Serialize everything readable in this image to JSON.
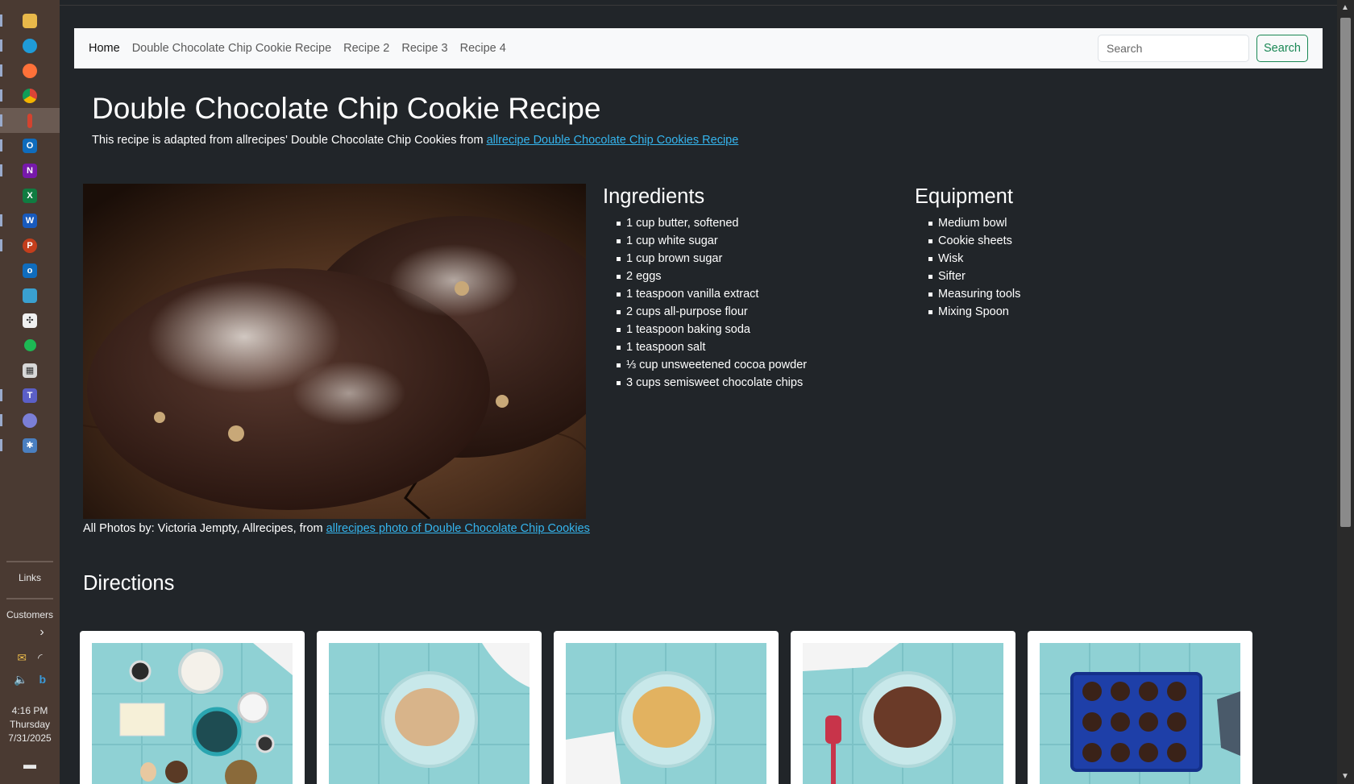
{
  "taskbar": {
    "icons": [
      "file-explorer",
      "edge",
      "firefox",
      "chrome",
      "app-pin",
      "outlook",
      "onenote",
      "excel",
      "word",
      "powerpoint",
      "outlook-alt",
      "app-tool",
      "puzzle",
      "green-circle",
      "calculator",
      "teams",
      "teams-alt",
      "app-gear"
    ],
    "links_label": "Links",
    "customers_label": "Customers",
    "time": "4:16 PM",
    "day": "Thursday",
    "date": "7/31/2025"
  },
  "navbar": {
    "home": "Home",
    "links": [
      "Double Chocolate Chip Cookie Recipe",
      "Recipe 2",
      "Recipe 3",
      "Recipe 4"
    ],
    "search_placeholder": "Search",
    "search_button": "Search"
  },
  "recipe": {
    "title": "Double Chocolate Chip Cookie Recipe",
    "subtitle": "This recipe is adapted from allrecipes' Double Chocolate Chip Cookies from ",
    "subtitle_link": "allrecipe Double Chocolate Chip Cookies Recipe",
    "credit": "All Photos by: Victoria Jempty, Allrecipes, from ",
    "credit_link": "allrecipes photo of Double Chocolate Chip Cookies",
    "ingredients_heading": "Ingredients",
    "ingredients": [
      "1 cup butter, softened",
      "1 cup white sugar",
      "1 cup brown sugar",
      "2 eggs",
      "1 teaspoon vanilla extract",
      "2 cups all-purpose flour",
      "1 teaspoon baking soda",
      "1 teaspoon salt",
      "⅓ cup unsweetened cocoa powder",
      "3 cups semisweet chocolate chips"
    ],
    "equipment_heading": "Equipment",
    "equipment": [
      "Medium bowl",
      "Cookie sheets",
      "Wisk",
      "Sifter",
      "Measuring tools",
      "Mixing Spoon"
    ],
    "directions_heading": "Directions"
  },
  "colors": {
    "page_bg": "#212529",
    "navbar_bg": "#f8f9fa",
    "link": "#35b5ee",
    "search_green": "#198754"
  }
}
